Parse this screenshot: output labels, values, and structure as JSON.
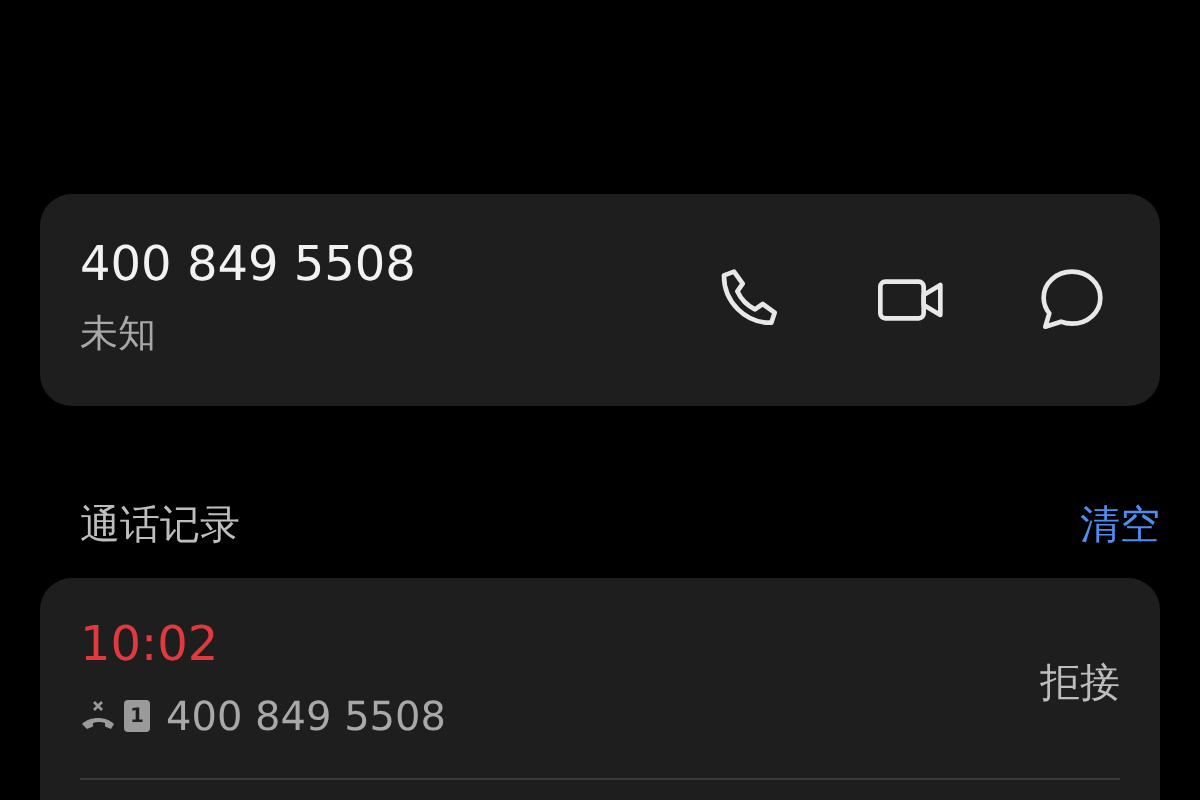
{
  "contact": {
    "number": "400 849 5508",
    "location": "未知"
  },
  "history": {
    "title": "通话记录",
    "clear": "清空",
    "entries": [
      {
        "time": "10:02",
        "missed": true,
        "sim_slot": "1",
        "number": "400 849 5508",
        "result": "拒接"
      }
    ]
  }
}
